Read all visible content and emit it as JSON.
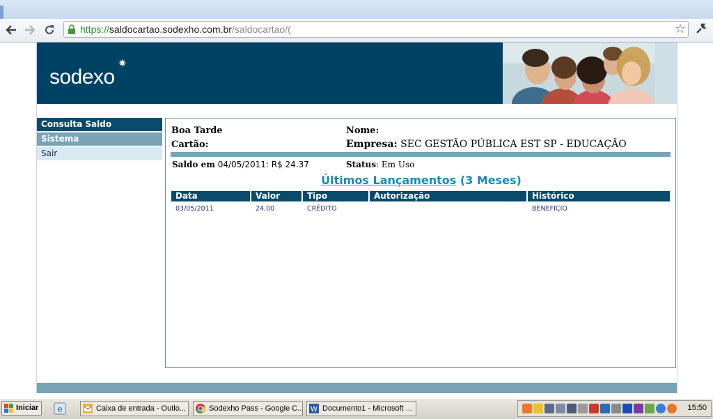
{
  "browser": {
    "url_scheme": "https://",
    "url_host": "saldocartao.sodexho.com.br",
    "url_path": "/saldocartao/("
  },
  "brand": {
    "logo_text": "sodexo"
  },
  "menu": {
    "items": [
      {
        "label": "Consulta Saldo"
      },
      {
        "label": "Sistema"
      },
      {
        "label": "Sair"
      }
    ]
  },
  "account": {
    "greeting": "Boa Tarde",
    "cartao_label": "Cartão:",
    "nome_label": "Nome:",
    "empresa_label": "Empresa:",
    "empresa_value": "SEC GESTÃO PÚBLICA EST SP - EDUCAÇÃO",
    "saldo_label": "Saldo em",
    "saldo_value": "04/05/2011: R$ 24.37",
    "status_label": "Status",
    "status_value": ": Em Uso"
  },
  "transactions": {
    "title_link": "Últimos Lançamentos",
    "title_suffix": "(3 Meses)",
    "columns": [
      "Data",
      "Valor",
      "Tipo",
      "Autorização",
      "Histórico"
    ],
    "rows": [
      [
        "03/05/2011",
        "24,00",
        "CRÉDITO",
        "",
        "BENEFICIO"
      ]
    ]
  },
  "taskbar": {
    "start_label": "Iniciar",
    "tasks": [
      {
        "label": "Caixa de entrada - Outlo..."
      },
      {
        "label": "Sodexho Pass - Google C..."
      },
      {
        "label": "Documento1 - Microsoft ..."
      }
    ],
    "clock": "15:50"
  },
  "colors": {
    "banner": "#004263",
    "menu_dark": "#0a4a6a",
    "menu_mid": "#79a3b6",
    "menu_light": "#d9e9f2",
    "link": "#1a87b8"
  }
}
